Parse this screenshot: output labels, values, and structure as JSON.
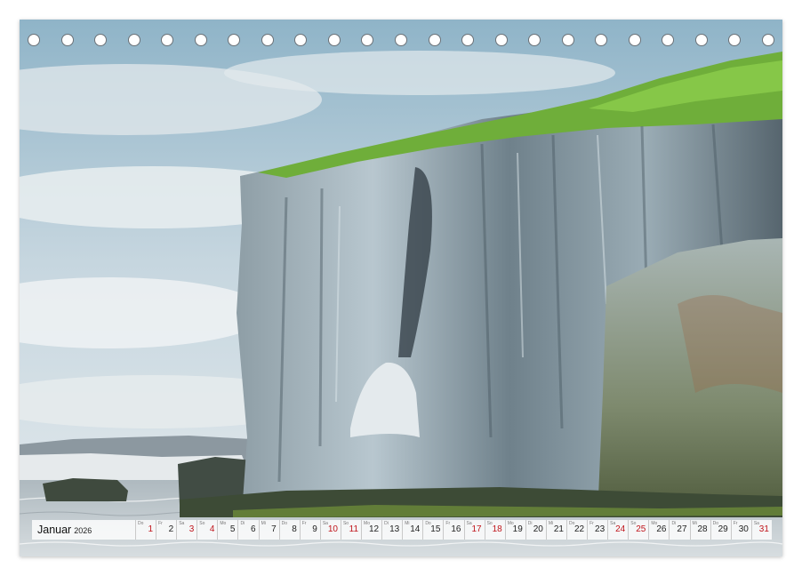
{
  "calendar": {
    "month": "Januar",
    "year": "2026",
    "days": [
      {
        "n": "1",
        "wd": "Do",
        "holiday": true
      },
      {
        "n": "2",
        "wd": "Fr",
        "holiday": false
      },
      {
        "n": "3",
        "wd": "Sa",
        "holiday": true
      },
      {
        "n": "4",
        "wd": "So",
        "holiday": true
      },
      {
        "n": "5",
        "wd": "Mo",
        "holiday": false
      },
      {
        "n": "6",
        "wd": "Di",
        "holiday": false
      },
      {
        "n": "7",
        "wd": "Mi",
        "holiday": false
      },
      {
        "n": "8",
        "wd": "Do",
        "holiday": false
      },
      {
        "n": "9",
        "wd": "Fr",
        "holiday": false
      },
      {
        "n": "10",
        "wd": "Sa",
        "holiday": true
      },
      {
        "n": "11",
        "wd": "So",
        "holiday": true
      },
      {
        "n": "12",
        "wd": "Mo",
        "holiday": false
      },
      {
        "n": "13",
        "wd": "Di",
        "holiday": false
      },
      {
        "n": "14",
        "wd": "Mi",
        "holiday": false
      },
      {
        "n": "15",
        "wd": "Do",
        "holiday": false
      },
      {
        "n": "16",
        "wd": "Fr",
        "holiday": false
      },
      {
        "n": "17",
        "wd": "Sa",
        "holiday": true
      },
      {
        "n": "18",
        "wd": "So",
        "holiday": true
      },
      {
        "n": "19",
        "wd": "Mo",
        "holiday": false
      },
      {
        "n": "20",
        "wd": "Di",
        "holiday": false
      },
      {
        "n": "21",
        "wd": "Mi",
        "holiday": false
      },
      {
        "n": "22",
        "wd": "Do",
        "holiday": false
      },
      {
        "n": "23",
        "wd": "Fr",
        "holiday": false
      },
      {
        "n": "24",
        "wd": "Sa",
        "holiday": true
      },
      {
        "n": "25",
        "wd": "So",
        "holiday": true
      },
      {
        "n": "26",
        "wd": "Mo",
        "holiday": false
      },
      {
        "n": "27",
        "wd": "Di",
        "holiday": false
      },
      {
        "n": "28",
        "wd": "Mi",
        "holiday": false
      },
      {
        "n": "29",
        "wd": "Do",
        "holiday": false
      },
      {
        "n": "30",
        "wd": "Fr",
        "holiday": false
      },
      {
        "n": "31",
        "wd": "Sa",
        "holiday": true
      }
    ]
  },
  "binding": {
    "hole_count": 23
  },
  "colors": {
    "sky": "#9fbfd0",
    "cloud": "#e6ecef",
    "rock_light": "#b9c9d2",
    "rock_dark": "#3b4a55",
    "grass": "#6fae3a",
    "sea": "#c9d2d6",
    "holiday": "#c0141b"
  }
}
